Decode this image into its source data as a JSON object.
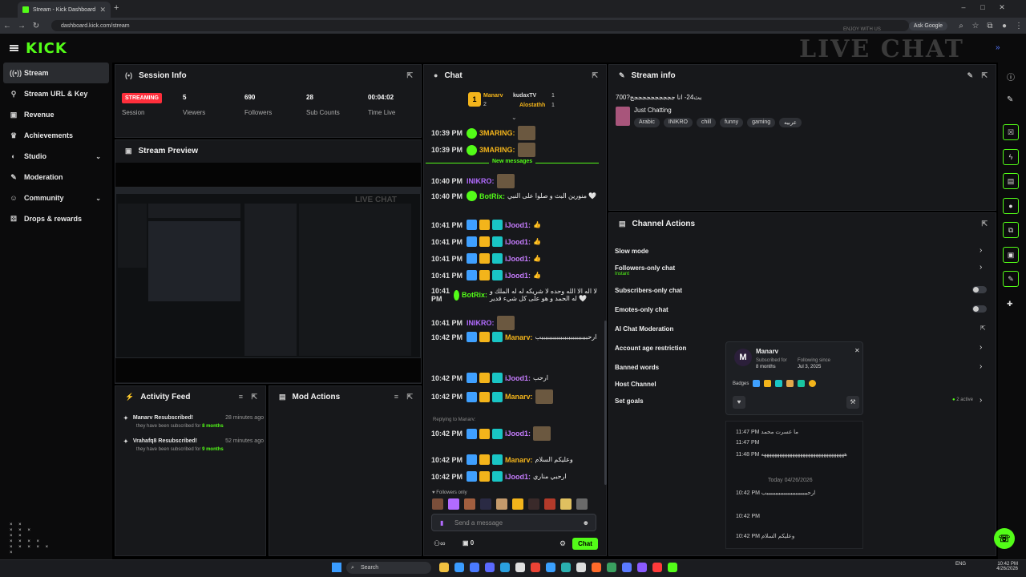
{
  "browser": {
    "tab_title": "Stream - Kick Dashboard",
    "url": "dashboard.kick.com/stream",
    "ask_google": "Ask Google"
  },
  "brand": {
    "logo": "KICK",
    "overlay": "LIVE CHAT",
    "enjoy": "ENJOY WITH US",
    "accent": "#53fc18"
  },
  "sidebar": {
    "items": [
      {
        "label": "Stream",
        "icon": "broadcast-icon"
      },
      {
        "label": "Stream URL & Key",
        "icon": "link-icon"
      },
      {
        "label": "Revenue",
        "icon": "revenue-icon"
      },
      {
        "label": "Achievements",
        "icon": "trophy-icon"
      },
      {
        "label": "Studio",
        "icon": "studio-icon"
      },
      {
        "label": "Moderation",
        "icon": "wrench-icon"
      },
      {
        "label": "Community",
        "icon": "people-icon"
      },
      {
        "label": "Drops & rewards",
        "icon": "gift-icon"
      }
    ]
  },
  "session": {
    "title": "Session Info",
    "status": "STREAMING",
    "status_label": "Session",
    "viewers": "5",
    "viewers_label": "Viewers",
    "followers": "690",
    "followers_label": "Followers",
    "subs": "28",
    "subs_label": "Sub Counts",
    "time": "00:04:02",
    "time_label": "Time Live"
  },
  "preview": {
    "title": "Stream Preview"
  },
  "activity": {
    "title": "Activity Feed",
    "items": [
      {
        "name": "Manarv Resubscribed!",
        "time": "28 minutes ago",
        "detail_pre": "they have been subscribed for",
        "months": "8 months"
      },
      {
        "name": "Vrahafq8 Resubscribed!",
        "time": "52 minutes ago",
        "detail_pre": "they have been subscribed for",
        "months": "9 months"
      }
    ]
  },
  "mod": {
    "title": "Mod Actions"
  },
  "chat": {
    "title": "Chat",
    "gifters": [
      {
        "name": "Manarv",
        "count": "2"
      },
      {
        "name": "kudaxTV",
        "count": "1"
      },
      {
        "name": "Alostathh",
        "count": "1"
      }
    ],
    "new_messages": "New messages",
    "messages": [
      {
        "time": "10:39 PM",
        "user": "3MARING:",
        "text": "",
        "color": "#f3b41b"
      },
      {
        "time": "10:39 PM",
        "user": "3MARING:",
        "text": "",
        "color": "#f3b41b"
      },
      {
        "time": "10:40 PM",
        "user": "INIKRO:",
        "text": "",
        "color": "#b26bff"
      },
      {
        "time": "10:40 PM",
        "user": "BotRix:",
        "text": "منورين البث و صلوا على النبي 🤍",
        "color": "#53fc18"
      },
      {
        "time": "10:41 PM",
        "user": "iJood1:",
        "text": "👍",
        "color": "#c77dff"
      },
      {
        "time": "10:41 PM",
        "user": "iJood1:",
        "text": "👍",
        "color": "#c77dff"
      },
      {
        "time": "10:41 PM",
        "user": "iJood1:",
        "text": "👍",
        "color": "#c77dff"
      },
      {
        "time": "10:41 PM",
        "user": "iJood1:",
        "text": "👍",
        "color": "#c77dff"
      },
      {
        "time": "10:41 PM",
        "user": "BotRix:",
        "text": "لا اله الا الله وحده لا شريكه له له الملك و له الحمد و هو على كل شيء قدير 🤍",
        "color": "#53fc18"
      },
      {
        "time": "10:41 PM",
        "user": "INIKRO:",
        "text": "",
        "color": "#b26bff"
      },
      {
        "time": "10:42 PM",
        "user": "Manarv:",
        "text": "ارحببببببببببببببببببببببببب",
        "color": "#f3b41b"
      },
      {
        "time": "10:42 PM",
        "user": "iJood1:",
        "text": "ارحب",
        "color": "#c77dff"
      },
      {
        "time": "10:42 PM",
        "user": "Manarv:",
        "text": "",
        "color": "#f3b41b"
      },
      {
        "time": "10:42 PM",
        "user": "iJood1:",
        "text": "",
        "color": "#c77dff",
        "reply": "Replying to Manarv:"
      },
      {
        "time": "10:42 PM",
        "user": "Manarv:",
        "text": "وعليكم السلام",
        "color": "#f3b41b"
      },
      {
        "time": "10:42 PM",
        "user": "iJood1:",
        "text": "ارحبي مناري",
        "color": "#c77dff"
      }
    ],
    "followers_only": "Followers only",
    "input_placeholder": "Send a message",
    "counter": "0",
    "send_label": "Chat"
  },
  "stream_info": {
    "title": "Stream info",
    "stream_title": "بث24- انا ججججججججججج?700",
    "category": "Just Chatting",
    "tags": [
      "Arabic",
      "INIKRO",
      "chill",
      "funny",
      "gaming",
      "عربيه"
    ]
  },
  "channel_actions": {
    "title": "Channel Actions",
    "rows": [
      {
        "label": "Slow mode"
      },
      {
        "label": "Followers-only chat",
        "sub": "Instant"
      },
      {
        "label": "Subscribers-only chat"
      },
      {
        "label": "Emotes-only chat"
      },
      {
        "label": "AI Chat Moderation"
      },
      {
        "label": "Account age restriction"
      },
      {
        "label": "Banned words"
      },
      {
        "label": "Host Channel"
      },
      {
        "label": "Set goals"
      }
    ],
    "goals_status": "2 active"
  },
  "user_card": {
    "name": "Manarv",
    "sub_label": "Subscribed for",
    "sub_value": "8 months",
    "follow_label": "Following since",
    "follow_value": "Jul 3, 2025",
    "badges_label": "Badges"
  },
  "history": {
    "lines": [
      {
        "time": "11:47 PM",
        "text": "ما عسرت محمد"
      },
      {
        "time": "11:47 PM",
        "text": ""
      },
      {
        "time": "11:48 PM",
        "text": "ههههههههههههههههههههههههههههههههه"
      },
      {
        "time": "",
        "text": "Today 04/26/2026"
      },
      {
        "time": "10:42 PM",
        "text": "ارحببببببببببببببببببببببببب"
      },
      {
        "time": "10:42 PM",
        "text": ""
      },
      {
        "time": "10:42 PM",
        "text": "وعليكم السلام"
      }
    ]
  },
  "taskbar": {
    "search": "Search",
    "lang": "ENG",
    "time": "10:42 PM",
    "date": "4/26/2026"
  }
}
